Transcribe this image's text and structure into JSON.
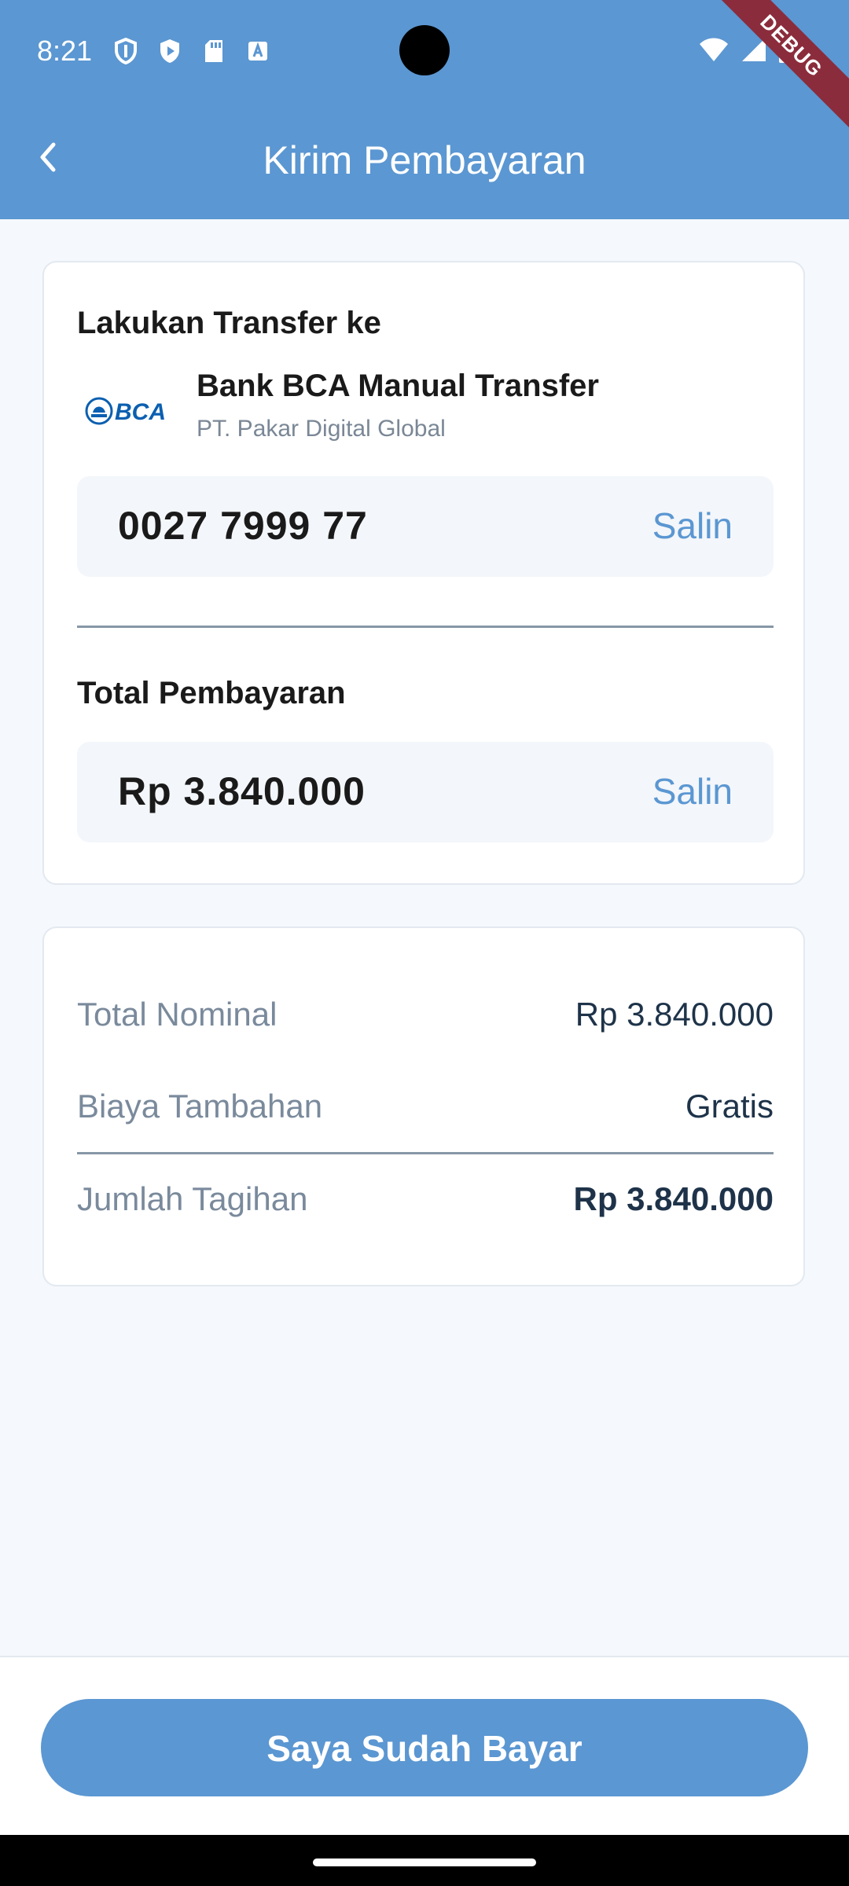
{
  "status_bar": {
    "time": "8:21",
    "debug_label": "DEBUG",
    "left_icons": [
      "shield-icon",
      "play-protect-icon",
      "sd-card-icon",
      "keyboard-a-icon"
    ],
    "right_icons": [
      "wifi-icon",
      "signal-icon",
      "battery-icon"
    ]
  },
  "app_bar": {
    "title": "Kirim Pembayaran",
    "back_icon": "chevron-left-icon"
  },
  "transfer": {
    "section_label": "Lakukan Transfer ke",
    "bank_logo_text": "BCA",
    "bank_name": "Bank BCA Manual Transfer",
    "account_holder": "PT. Pakar Digital Global",
    "account_number": "0027 7999 77",
    "copy_label": "Salin"
  },
  "total": {
    "section_label": "Total Pembayaran",
    "amount": "Rp 3.840.000",
    "copy_label": "Salin"
  },
  "summary": {
    "rows": [
      {
        "label": "Total Nominal",
        "value": "Rp 3.840.000"
      },
      {
        "label": "Biaya Tambahan",
        "value": "Gratis"
      },
      {
        "label": "Jumlah Tagihan",
        "value": "Rp 3.840.000"
      }
    ]
  },
  "actions": {
    "paid_button": "Saya Sudah Bayar"
  },
  "colors": {
    "primary": "#5b97d2",
    "debug_banner": "#8b2c3c",
    "background": "#f5f8fc"
  }
}
